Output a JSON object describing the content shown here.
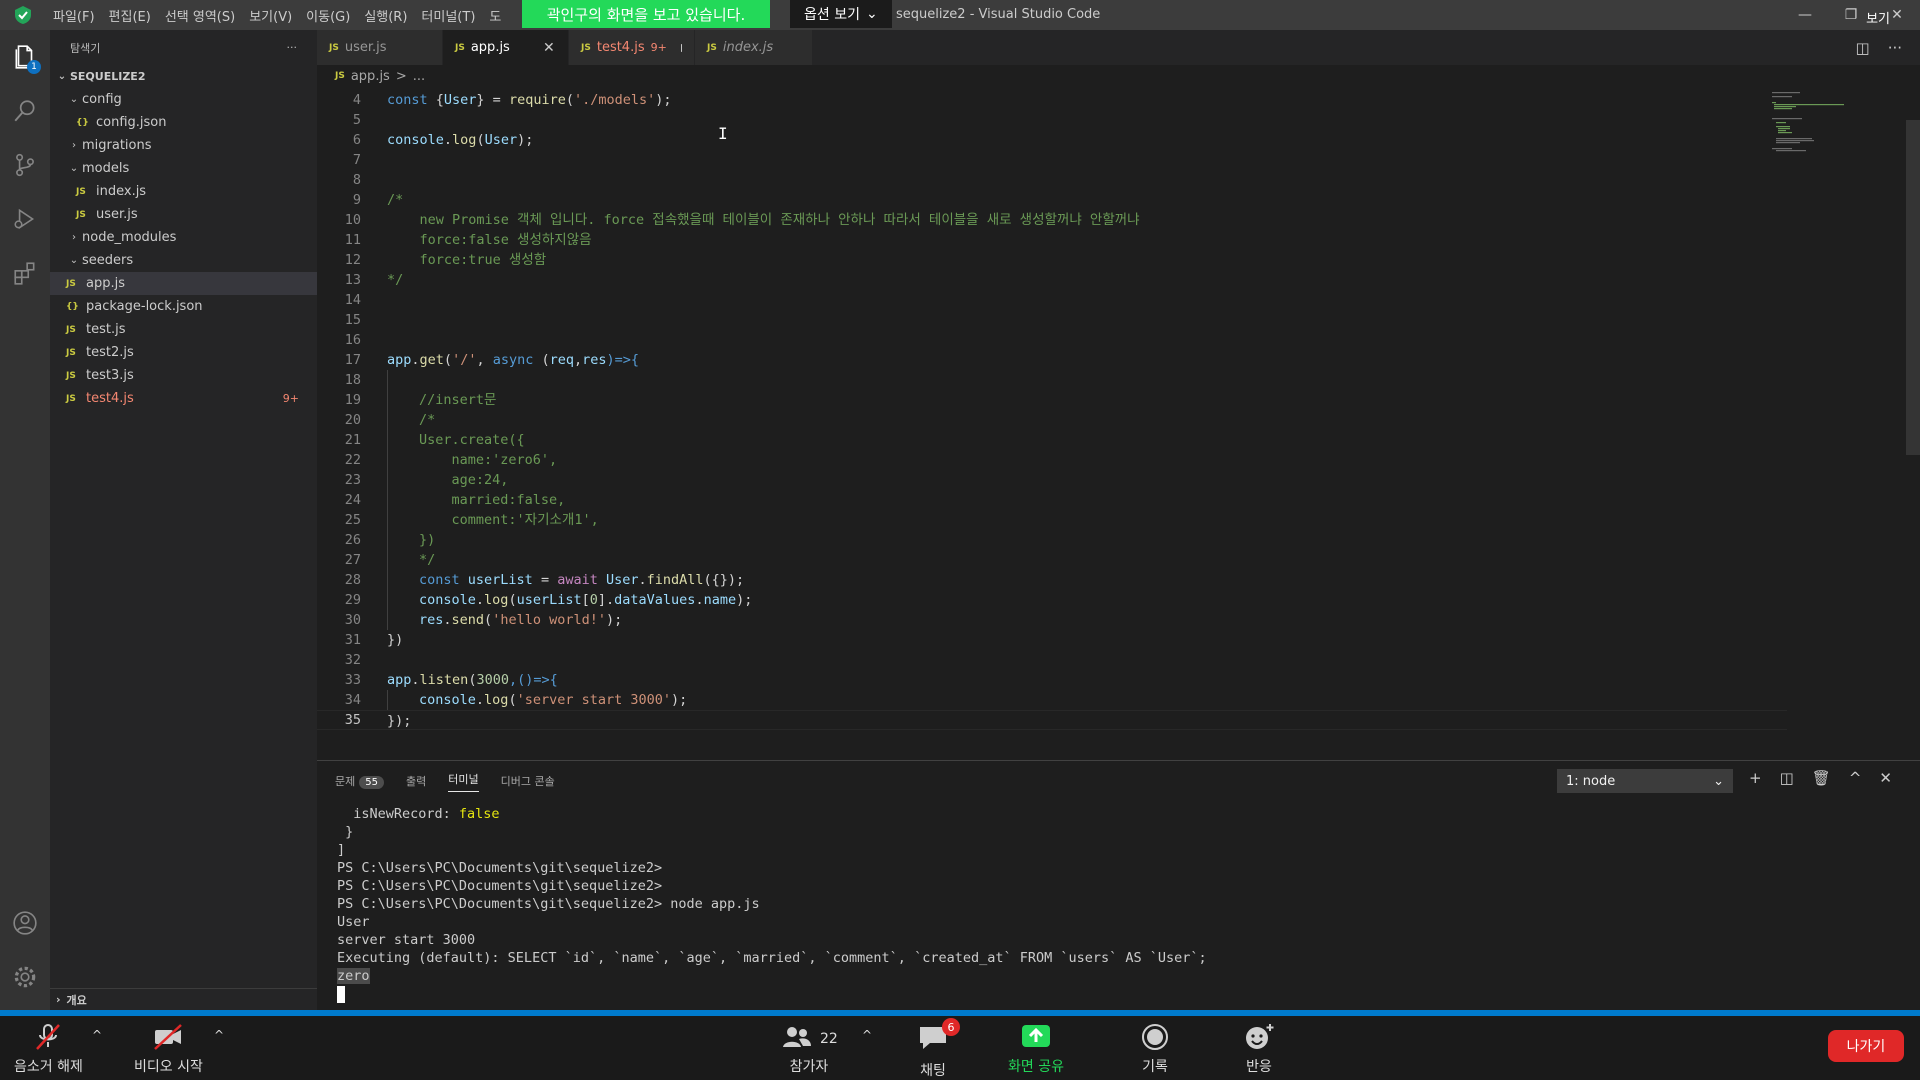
{
  "titlebar": {
    "menu": [
      "파일(F)",
      "편집(E)",
      "선택 영역(S)",
      "보기(V)",
      "이동(G)",
      "실행(R)",
      "터미널(T)",
      "도"
    ],
    "title": "sequelize2 - Visual Studio Code",
    "minimize": "—",
    "maximize": "❐",
    "close": "✕"
  },
  "share_banner": {
    "text": "곽인구의 화면을 보고 있습니다.",
    "view_options": "옵션 보기",
    "view_right": "보기"
  },
  "activity": {
    "explorer_badge": "1"
  },
  "sidebar": {
    "header": "탐색기",
    "more": "···",
    "root": "SEQUELIZE2",
    "items": [
      {
        "label": "config",
        "type": "folder",
        "open": true,
        "depth": 1
      },
      {
        "label": "config.json",
        "type": "json",
        "depth": 2
      },
      {
        "label": "migrations",
        "type": "folder",
        "open": false,
        "depth": 1
      },
      {
        "label": "models",
        "type": "folder",
        "open": true,
        "depth": 1
      },
      {
        "label": "index.js",
        "type": "js",
        "depth": 2
      },
      {
        "label": "user.js",
        "type": "js",
        "depth": 2
      },
      {
        "label": "node_modules",
        "type": "folder",
        "open": false,
        "depth": 1
      },
      {
        "label": "seeders",
        "type": "folder",
        "open": true,
        "depth": 1
      },
      {
        "label": "app.js",
        "type": "js",
        "depth": 1,
        "selected": true
      },
      {
        "label": "package-lock.json",
        "type": "json",
        "depth": 1
      },
      {
        "label": "test.js",
        "type": "js",
        "depth": 1
      },
      {
        "label": "test2.js",
        "type": "js",
        "depth": 1
      },
      {
        "label": "test3.js",
        "type": "js",
        "depth": 1
      },
      {
        "label": "test4.js",
        "type": "js",
        "depth": 1,
        "error": true,
        "count": "9+"
      }
    ],
    "outline": "개요"
  },
  "tabs": [
    {
      "label": "user.js",
      "state": "normal"
    },
    {
      "label": "app.js",
      "state": "active",
      "close": "✕"
    },
    {
      "label": "test4.js",
      "state": "error",
      "err": "9+"
    },
    {
      "label": "index.js",
      "state": "italic"
    }
  ],
  "breadcrumb": {
    "file": "app.js",
    "sep": ">",
    "rest": "..."
  },
  "editor": {
    "lines": [
      {
        "n": "4"
      },
      {
        "n": "5"
      },
      {
        "n": "6"
      },
      {
        "n": "7"
      },
      {
        "n": "8"
      },
      {
        "n": "9"
      },
      {
        "n": "10"
      },
      {
        "n": "11"
      },
      {
        "n": "12"
      },
      {
        "n": "13"
      },
      {
        "n": "14"
      },
      {
        "n": "15"
      },
      {
        "n": "16"
      },
      {
        "n": "17"
      },
      {
        "n": "18"
      },
      {
        "n": "19"
      },
      {
        "n": "20"
      },
      {
        "n": "21"
      },
      {
        "n": "22"
      },
      {
        "n": "23"
      },
      {
        "n": "24"
      },
      {
        "n": "25"
      },
      {
        "n": "26"
      },
      {
        "n": "27"
      },
      {
        "n": "28"
      },
      {
        "n": "29"
      },
      {
        "n": "30"
      },
      {
        "n": "31"
      },
      {
        "n": "32"
      },
      {
        "n": "33"
      },
      {
        "n": "34"
      },
      {
        "n": "35"
      }
    ],
    "code": {
      "l4": [
        "const",
        " {",
        "User",
        "} = ",
        "require",
        "(",
        "'./models'",
        ");"
      ],
      "l6": [
        "console",
        ".",
        "log",
        "(",
        "User",
        ");"
      ],
      "l9": "/*",
      "l10": "    new Promise 객체 입니다. force 접속했을때 테이블이 존재하나 안하나 따라서 테이블을 새로 생성할꺼냐 안할꺼냐",
      "l11": "    force:false 생성하지않음",
      "l12": "    force:true 생성함",
      "l13": "*/",
      "l17": [
        "app",
        ".",
        "get",
        "(",
        "'/'",
        ", ",
        "async",
        " (",
        "req",
        ",",
        "res",
        ")=>{"
      ],
      "l19": "//insert문",
      "l20": "/*",
      "l21": "User.create({",
      "l22": "    name:'zero6',",
      "l23": "    age:24,",
      "l24": "    married:false,",
      "l25": "    comment:'자기소개1',",
      "l26": "})",
      "l27": "*/",
      "l28": [
        "const",
        " ",
        "userList",
        " = ",
        "await",
        " ",
        "User",
        ".",
        "findAll",
        "({});"
      ],
      "l29": [
        "console",
        ".",
        "log",
        "(",
        "userList",
        "[",
        "0",
        "].",
        "dataValues",
        ".",
        "name",
        ");"
      ],
      "l30": [
        "res",
        ".",
        "send",
        "(",
        "'hello world!'",
        ");"
      ],
      "l31": "})",
      "l33": [
        "app",
        ".",
        "listen",
        "(",
        "3000",
        ",()=>{"
      ],
      "l34": [
        "console",
        ".",
        "log",
        "(",
        "'server start 3000'",
        ");"
      ],
      "l35": "});"
    }
  },
  "panel": {
    "tabs": {
      "problems": "문제",
      "problems_count": "55",
      "output": "출력",
      "terminal": "터미널",
      "debug": "디버그 콘솔"
    },
    "terminal_select": "1: node",
    "terminal": {
      "l1a": "  isNewRecord: ",
      "l1b": "false",
      "l2": " }",
      "l3": "]",
      "l4": "PS C:\\Users\\PC\\Documents\\git\\sequelize2>",
      "l5": "PS C:\\Users\\PC\\Documents\\git\\sequelize2>",
      "l6": "PS C:\\Users\\PC\\Documents\\git\\sequelize2> node app.js",
      "l7": "User",
      "l8": "server start 3000",
      "l9": "Executing (default): SELECT `id`, `name`, `age`, `married`, `comment`, `created_at` FROM `users` AS `User`;",
      "l10": "zero"
    }
  },
  "zoom": {
    "unmute": "음소거 해제",
    "start_video": "비디오 시작",
    "participants": "참가자",
    "participants_count": "22",
    "chat": "채팅",
    "chat_badge": "6",
    "share": "화면 공유",
    "record": "기록",
    "reactions": "반응",
    "leave": "나가기",
    "colors": {
      "leave": "#e02828",
      "share": "#23d959"
    }
  }
}
